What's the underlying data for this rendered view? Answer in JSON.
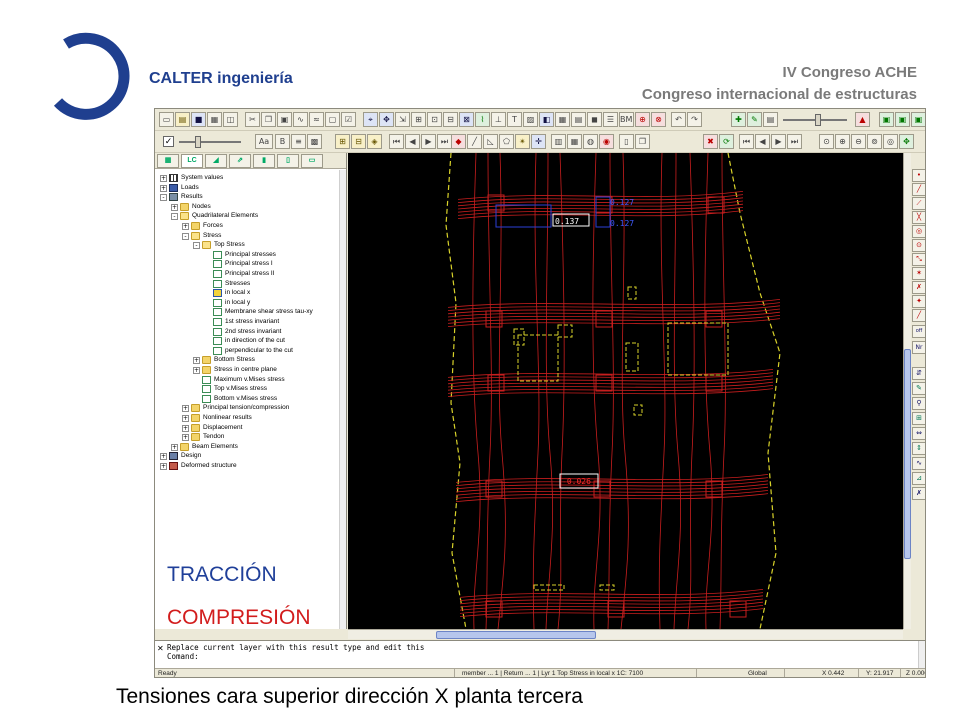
{
  "slide": {
    "brand": "CALTER ingeniería",
    "congress_line1": "IV Congreso ACHE",
    "congress_line2": "Congreso internacional de estructuras",
    "caption": "Tensiones cara superior dirección X planta tercera",
    "logo_color": "#1f3f8f"
  },
  "panel_tabs": [
    "LC"
  ],
  "tree": {
    "items": [
      {
        "label": "System values",
        "icon": "grid-icon"
      },
      {
        "label": "Loads",
        "icon": "load-icon"
      },
      {
        "label": "Results",
        "icon": "results-icon"
      },
      {
        "label": "Nodes",
        "icon": "folder-icon"
      },
      {
        "label": "Quadrilateral Elements",
        "icon": "folder-open-icon"
      },
      {
        "label": "Forces",
        "icon": "folder-icon"
      },
      {
        "label": "Stress",
        "icon": "folder-open-icon"
      },
      {
        "label": "Top Stress",
        "icon": "folder-open-icon"
      },
      {
        "label": "Principal stresses",
        "icon": "page-icon"
      },
      {
        "label": "Principal stress I",
        "icon": "page-icon"
      },
      {
        "label": "Principal stress II",
        "icon": "page-icon"
      },
      {
        "label": "Stresses",
        "icon": "page-icon"
      },
      {
        "label": "in local x",
        "icon": "selected-page-icon"
      },
      {
        "label": "in local y",
        "icon": "page-icon"
      },
      {
        "label": "Membrane shear stress tau-xy",
        "icon": "page-icon"
      },
      {
        "label": "1st stress invariant",
        "icon": "page-icon"
      },
      {
        "label": "2nd stress invariant",
        "icon": "page-icon"
      },
      {
        "label": "in direction of the cut",
        "icon": "page-icon"
      },
      {
        "label": "perpendicular to the cut",
        "icon": "page-icon"
      },
      {
        "label": "Bottom Stress",
        "icon": "folder-icon"
      },
      {
        "label": "Stress in centre plane",
        "icon": "folder-icon"
      },
      {
        "label": "Maximum v.Mises stress",
        "icon": "page-icon"
      },
      {
        "label": "Top v.Mises stress",
        "icon": "page-icon"
      },
      {
        "label": "Bottom v.Mises stress",
        "icon": "page-icon"
      },
      {
        "label": "Principal tension/compression",
        "icon": "folder-icon"
      },
      {
        "label": "Nonlinear results",
        "icon": "folder-icon"
      },
      {
        "label": "Displacement",
        "icon": "folder-icon"
      },
      {
        "label": "Tendon",
        "icon": "folder-icon"
      },
      {
        "label": "Beam Elements",
        "icon": "folder-icon"
      },
      {
        "label": "Design",
        "icon": "design-icon"
      },
      {
        "label": "Deformed structure",
        "icon": "deformed-icon"
      }
    ]
  },
  "legend": {
    "tension": "TRACCIÓN",
    "compression": "COMPRESIÓN",
    "tension_color": "#1f3f99",
    "compression_color": "#d21c1c"
  },
  "canvas": {
    "labels": [
      "0.127",
      "0.137",
      "0.127",
      "-0.026"
    ],
    "background": "#000000",
    "contour_color": "#c81e1e",
    "outline_color": "#d8d22a"
  },
  "toolbar": {
    "font_button": "Aa",
    "bmk_label": "BMK"
  },
  "command": {
    "line1": "Replace current layer with this result type and edit this",
    "line2": "Comand:"
  },
  "status": {
    "ready": "Ready",
    "layer": "member  ... 1 | Return ... 1 | Lyr   1  Top Stress in local x  1C: 7100",
    "global": "Global",
    "x": "X 0.442",
    "y": "Y: 21.917",
    "z": "Z 0.000"
  }
}
